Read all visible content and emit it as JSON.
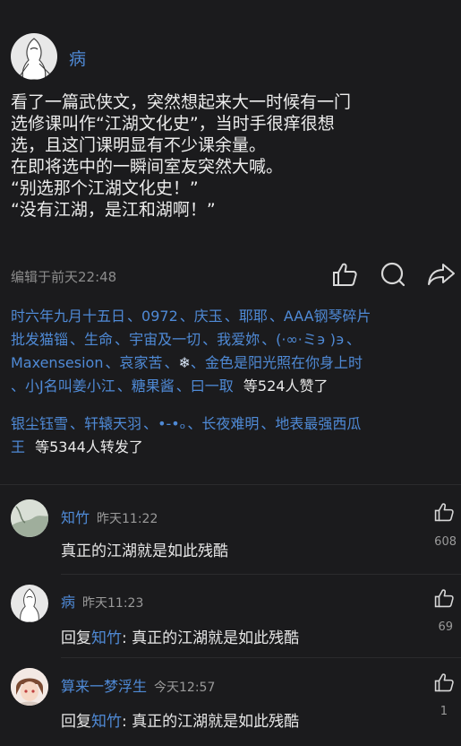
{
  "post": {
    "author": "病",
    "lines": [
      "看了一篇武侠文，突然想起来大一时候有一门",
      "选修课叫作“江湖文化史”，当时手很痒很想",
      "选，且这门课明显有不少课余量。",
      "在即将选中的一瞬间室友突然大喊。",
      "“别选那个江湖文化史！”",
      "“没有江湖，是江和湖啊！”"
    ],
    "edited": "编辑于前天22:48"
  },
  "actions": {
    "like_icon": "thumbs-up-icon",
    "comment_icon": "speech-bubble-icon",
    "share_icon": "share-arrow-icon"
  },
  "likes": {
    "line1": [
      "时六年九月十五日",
      "0972",
      "庆玉",
      "耶耶",
      "AAA钢琴碎片"
    ],
    "line2": [
      "批发猫锱",
      "生命",
      "宇宙及一切",
      "我爱妳",
      "(·∞·ミ϶ )϶"
    ],
    "line3": [
      "Maxensesion",
      "哀家苦",
      "❄",
      "金色是阳光照在你身上时"
    ],
    "line4": [
      "小J名叫姜小江",
      "糖果酱",
      "曰一取"
    ],
    "summary": "等524人赞了"
  },
  "reposts": {
    "line1": [
      "银尘钰雪",
      "轩辕天羽",
      "•-•ₒ",
      "长夜难明",
      "地表最强西瓜"
    ],
    "line2": [
      "王"
    ],
    "summary": "等5344人转发了"
  },
  "comments": [
    {
      "name": "知竹",
      "time": "昨天11:22",
      "text": "真正的江湖就是如此残酷",
      "likes": "608"
    },
    {
      "name": "病",
      "time": "昨天11:23",
      "reply_prefix": "回复",
      "reply_to": "知竹",
      "text": ": 真正的江湖就是如此残酷",
      "likes": "69"
    },
    {
      "name": "算来一梦浮生",
      "time": "今天12:57",
      "reply_prefix": "回复",
      "reply_to": "知竹",
      "text": ": 真正的江湖就是如此残酷",
      "likes": "1"
    }
  ],
  "colors": {
    "background": "#1b1b1d",
    "link": "#4f8ad6",
    "text": "#e9e9e9"
  }
}
